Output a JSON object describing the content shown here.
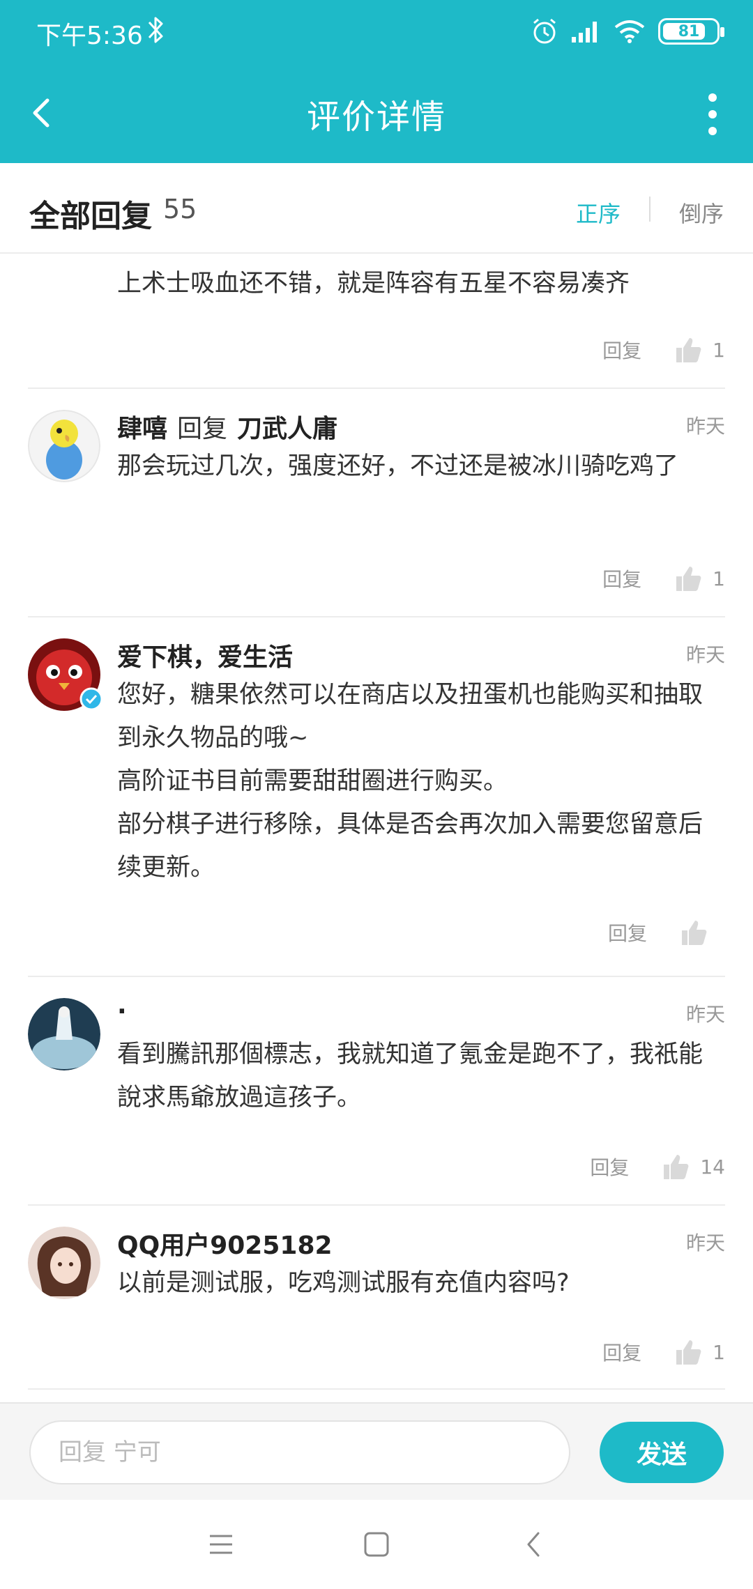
{
  "status_bar": {
    "time": "下午5:36",
    "battery": "81",
    "battery_level": 0.81
  },
  "header": {
    "title": "评价详情",
    "back_icon": "back-arrow-icon",
    "more_icon": "more-vertical-icon"
  },
  "subheader": {
    "label": "全部回复",
    "count": "55",
    "sort_asc": "正序",
    "sort_desc": "倒序"
  },
  "comments": [
    {
      "username": "",
      "text": [
        "上术士吸血还不错，就是阵容有五星不容易凑齐"
      ],
      "reply": "回复",
      "likes": "1"
    },
    {
      "username": "肆嘻",
      "reply_word": "回复",
      "reply_to": "刀武人庸",
      "date": "昨天",
      "text": [
        "那会玩过几次，强度还好，不过还是被冰川骑吃鸡了"
      ],
      "reply": "回复",
      "likes": "1"
    },
    {
      "username": "爱下棋，爱生活",
      "date": "昨天",
      "verified": true,
      "text": [
        "您好，糖果依然可以在商店以及扭蛋机也能购买和抽取到永久物品的哦~",
        "高阶证书目前需要甜甜圈进行购买。",
        "部分棋子进行移除，具体是否会再次加入需要您留意后续更新。"
      ],
      "reply": "回复",
      "likes": ""
    },
    {
      "username": ".",
      "date": "昨天",
      "text": [
        "看到騰訊那個標志，我就知道了氪金是跑不了，我祇能說求馬爺放過這孩子。"
      ],
      "reply": "回复",
      "likes": "14"
    },
    {
      "username": "QQ用户9025182",
      "date": "昨天",
      "text": [
        "以前是测试服，吃鸡测试服有充值内容吗?"
      ],
      "reply": "回复",
      "likes": "1"
    }
  ],
  "input": {
    "placeholder": "回复 宁可",
    "send_label": "发送"
  },
  "colors": {
    "accent": "#1ebac8",
    "text": "#333333",
    "muted": "#999999"
  }
}
